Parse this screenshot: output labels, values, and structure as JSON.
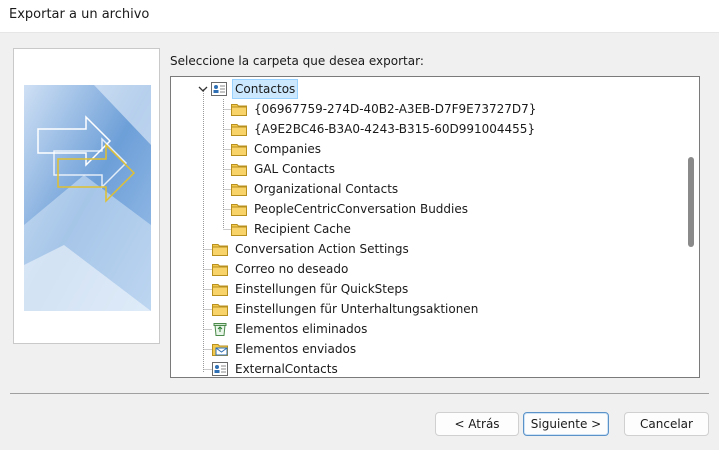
{
  "window": {
    "title": "Exportar a un archivo"
  },
  "prompt": "Seleccione la carpeta que desea exportar:",
  "tree": {
    "root": {
      "label": "Contactos",
      "icon": "contacts-icon",
      "expanded": true,
      "selected": true
    },
    "children": [
      {
        "label": "{06967759-274D-40B2-A3EB-D7F9E73727D7}",
        "icon": "folder-icon"
      },
      {
        "label": "{A9E2BC46-B3A0-4243-B315-60D991004455}",
        "icon": "folder-icon"
      },
      {
        "label": "Companies",
        "icon": "folder-icon"
      },
      {
        "label": "GAL Contacts",
        "icon": "folder-icon"
      },
      {
        "label": "Organizational Contacts",
        "icon": "folder-icon"
      },
      {
        "label": "PeopleCentricConversation Buddies",
        "icon": "folder-icon"
      },
      {
        "label": "Recipient Cache",
        "icon": "folder-icon"
      }
    ],
    "siblings": [
      {
        "label": "Conversation Action Settings",
        "icon": "folder-icon"
      },
      {
        "label": "Correo no deseado",
        "icon": "folder-icon"
      },
      {
        "label": "Einstellungen für QuickSteps",
        "icon": "folder-icon"
      },
      {
        "label": "Einstellungen für Unterhaltungsaktionen",
        "icon": "folder-icon"
      },
      {
        "label": "Elementos eliminados",
        "icon": "recycle-bin-icon"
      },
      {
        "label": "Elementos enviados",
        "icon": "sent-items-icon"
      },
      {
        "label": "ExternalContacts",
        "icon": "contacts-icon"
      }
    ]
  },
  "buttons": {
    "back": "< Atrás",
    "next": "Siguiente >",
    "cancel": "Cancelar"
  },
  "colors": {
    "selection": "#cce8ff",
    "folder": "#f2c94c",
    "primary_border": "#5b93c9"
  }
}
